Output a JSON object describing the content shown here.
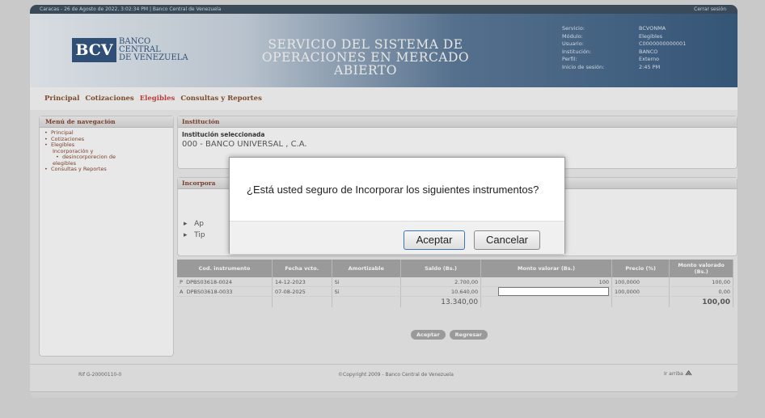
{
  "topbar": {
    "date": "Caracas - 26 de Agosto de 2022, 3:02:34 PM",
    "separator": "|",
    "bank": "Banco Central de Venezuela",
    "logout": "Cerrar sesión"
  },
  "header": {
    "logo_mark": "BCV",
    "logo_lines": [
      "BANCO",
      "CENTRAL",
      "DE VENEZUELA"
    ],
    "system_title": "SERVICIO DEL SISTEMA DE OPERACIONES EN MERCADO ABIERTO",
    "session": [
      {
        "k": "Servicio:",
        "v": "BCVONMA"
      },
      {
        "k": "Módulo:",
        "v": "Elegibles"
      },
      {
        "k": "Usuario:",
        "v": "C0000000000001"
      },
      {
        "k": "Institución:",
        "v": "BANCO"
      },
      {
        "k": "Perfil:",
        "v": "Externo"
      },
      {
        "k": "Inicio de sesión:",
        "v": "2:45 PM"
      }
    ]
  },
  "nav": {
    "items": [
      "Principal",
      "Cotizaciones",
      "Elegibles",
      "Consultas y Reportes"
    ]
  },
  "sidebar": {
    "title": "Menú de navegación",
    "items": [
      "Principal",
      "Cotizaciones",
      "Elegibles",
      "Incorporación y",
      "desincorporecion de",
      "elegibles",
      "Consultas y Reportes"
    ]
  },
  "institucion": {
    "title": "Institución",
    "label": "Institución seleccionada",
    "value": "000 - BANCO UNIVERSAL , C.A."
  },
  "incorporacion": {
    "title": "Incorpora",
    "bullet1": "Ap",
    "bullet2": "Tip"
  },
  "table": {
    "headers": [
      "Cod. instrumento",
      "Fecha vcto.",
      "Amortizable",
      "Saldo (Bs.)",
      "Monto valorar (Bs.)",
      "Precio (%)",
      "Monto valorado (Bs.)"
    ],
    "rows": [
      {
        "flag": "P",
        "code": "DPBS03618-0024",
        "date": "14-12-2023",
        "amort": "Si",
        "saldo": "2.700,00",
        "monto": "100",
        "precio": "100,0000",
        "valorado": "100,00"
      },
      {
        "flag": "A",
        "code": "DPBS03618-0033",
        "date": "07-08-2025",
        "amort": "Si",
        "saldo": "10.640,00",
        "monto": "",
        "precio": "100,0000",
        "valorado": "0,00"
      }
    ],
    "total_saldo": "13.340,00",
    "total_valorado": "100,00"
  },
  "page_buttons": {
    "accept": "Aceptar",
    "back": "Regresar"
  },
  "footer": {
    "ref": "Rif G-20000110-0",
    "copyright": "©Copyright 2009 - Banco Central de Venezuela",
    "top": "Ir arriba"
  },
  "dialog": {
    "message": "¿Está usted seguro de Incorporar los siguientes instrumentos?",
    "accept": "Aceptar",
    "cancel": "Cancelar"
  }
}
